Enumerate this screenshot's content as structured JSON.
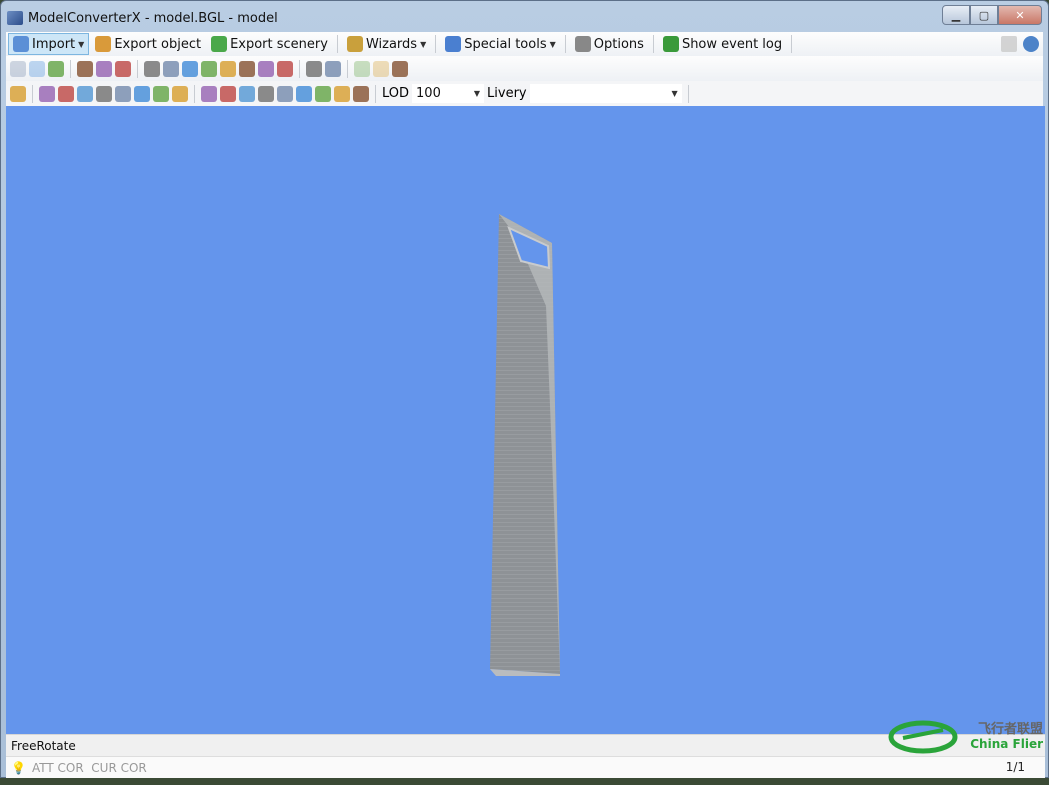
{
  "window": {
    "title": "ModelConverterX - model.BGL - model",
    "controls": [
      "minimize",
      "maximize",
      "close"
    ]
  },
  "menubar": {
    "items": [
      {
        "label": "Import",
        "icon": "folder-icon",
        "color": "#5b8fd6",
        "dropdown": true
      },
      {
        "label": "Export object",
        "icon": "house-export-icon",
        "color": "#d99a3a"
      },
      {
        "label": "Export scenery",
        "icon": "globe-export-icon",
        "color": "#4aa84a"
      },
      {
        "label": "Wizards",
        "icon": "wand-icon",
        "color": "#c9a03c",
        "dropdown": true
      },
      {
        "label": "Special tools",
        "icon": "gear-icon",
        "color": "#4a7fd0",
        "dropdown": true
      },
      {
        "label": "Options",
        "icon": "tools-icon",
        "color": "#888888"
      },
      {
        "label": "Show event log",
        "icon": "arrows-updown-icon",
        "color": "#3a9a3a"
      }
    ],
    "right_icons": [
      "details-icon",
      "help-icon"
    ]
  },
  "toolbar2": {
    "icons": [
      "back-icon",
      "forward-icon",
      "document-icon",
      "|",
      "zoom-view-icon",
      "placemark-icon",
      "hierarchy-icon",
      "|",
      "texture-icon",
      "material-icon",
      "animation-icon",
      "image-icon",
      "globe-icon",
      "map-icon",
      "link-icon",
      "figure-icon",
      "|",
      "screenshot-icon",
      "report-icon",
      "|",
      "undo-icon",
      "redo-icon",
      "clock-icon"
    ]
  },
  "toolbar3": {
    "icons": [
      "fit-view-icon",
      "|",
      "grid-icon",
      "axes-icon",
      "paperclip-icon",
      "particles-icon",
      "wireframe-icon",
      "brick-texture-icon",
      "lightmap-icon",
      "ground-icon",
      "|",
      "camera-icon",
      "shader-icon",
      "cube-color-icon",
      "textured-icon",
      "sphere-icon",
      "normals-icon",
      "checker-icon",
      "light-icon",
      "refresh-icon"
    ],
    "lod_label": "LOD",
    "lod_value": "100",
    "livery_label": "Livery",
    "livery_value": ""
  },
  "viewport": {
    "background": "#6495ec",
    "mode": "FreeRotate"
  },
  "statusbar": {
    "indicators": "ATT COR  CUR COR",
    "page": "1/1"
  },
  "watermark": {
    "cn": "飞行者联盟",
    "en": "China Flier"
  }
}
